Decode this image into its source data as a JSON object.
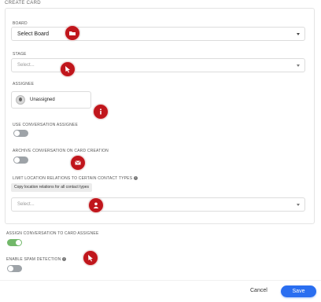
{
  "title": "CREATE CARD",
  "board": {
    "label": "BOARD",
    "value": "Select Board"
  },
  "stage": {
    "label": "STAGE",
    "placeholder": "Select..."
  },
  "assignee": {
    "label": "ASSIGNEE",
    "value": "Unassigned"
  },
  "use_conversation_assignee": {
    "label": "USE CONVERSATION ASSIGNEE",
    "enabled": false
  },
  "archive_conversation": {
    "label": "ARCHIVE CONVERSATION ON CARD CREATION",
    "enabled": false
  },
  "limit_location": {
    "label": "LIMIT LOCATION RELATIONS TO CERTAIN CONTACT TYPES",
    "copy_chip": "Copy location relations for all contact types",
    "placeholder": "Select..."
  },
  "assign_conversation": {
    "label": "ASSIGN CONVERSATION TO CARD ASSIGNEE",
    "enabled": true
  },
  "spam_detection": {
    "label": "ENABLE SPAM DETECTION",
    "enabled": false
  },
  "footer": {
    "cancel": "Cancel",
    "save": "Save"
  },
  "colors": {
    "marker": "#c0161c",
    "save": "#2a6ef0",
    "toggle_on": "#72b86a",
    "toggle_off": "#9ea3a8"
  },
  "markers": [
    "folder-icon",
    "cursor-icon",
    "info-icon",
    "envelope-icon",
    "person-icon",
    "cursor-icon"
  ]
}
